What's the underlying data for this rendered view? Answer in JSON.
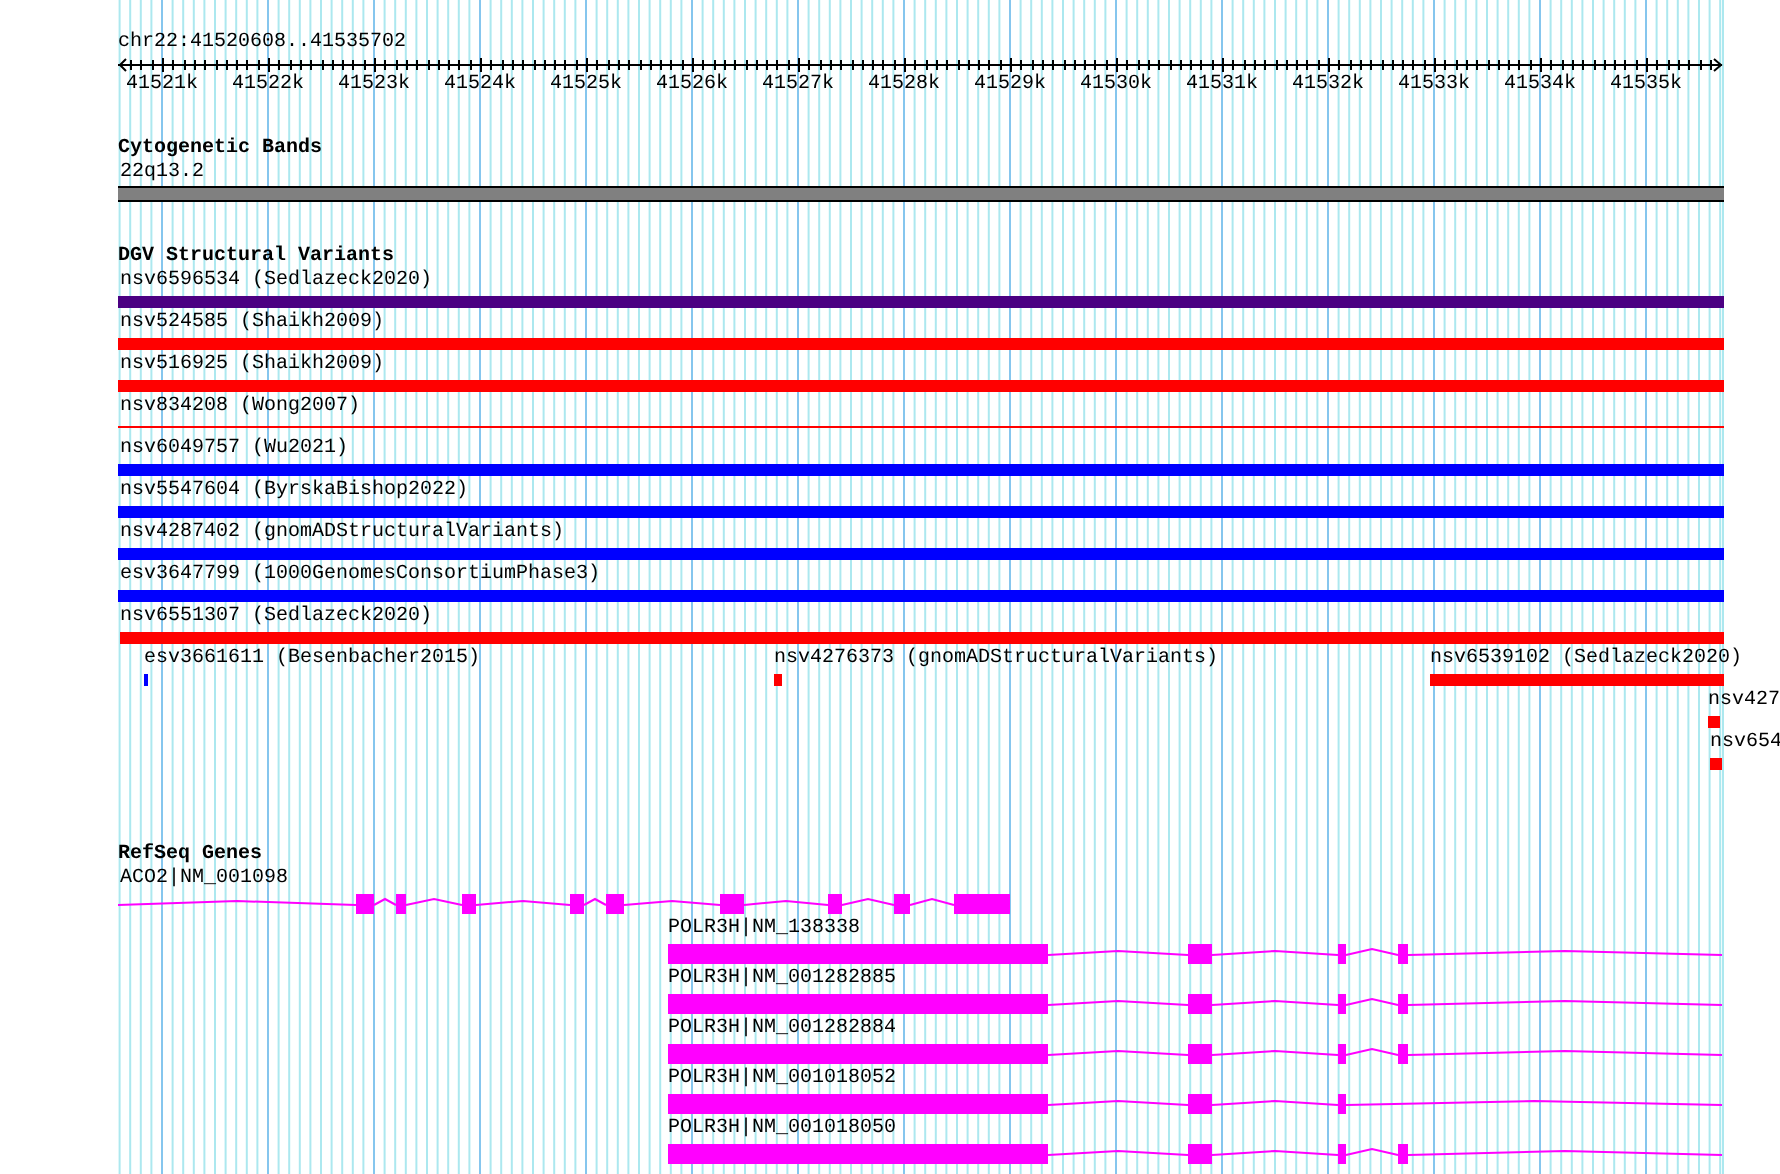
{
  "location": "chr22:41520608..41535702",
  "ruler": {
    "ticks": [
      "41521k",
      "41522k",
      "41523k",
      "41524k",
      "41525k",
      "41526k",
      "41527k",
      "41528k",
      "41529k",
      "41530k",
      "41531k",
      "41532k",
      "41533k",
      "41534k",
      "41535k"
    ]
  },
  "tracks": [
    {
      "kind": "bands",
      "title": "Cytogenetic Bands",
      "features": [
        {
          "label": "22q13.2"
        }
      ]
    },
    {
      "kind": "variants",
      "title": "DGV Structural Variants",
      "rows": [
        {
          "features": [
            {
              "label": "nsv6596534 (Sedlazeck2020)",
              "color": "#4b0082",
              "kind": "bar"
            }
          ]
        },
        {
          "features": [
            {
              "label": "nsv524585 (Shaikh2009)",
              "color": "#ff0000",
              "kind": "bar"
            }
          ]
        },
        {
          "features": [
            {
              "label": "nsv516925 (Shaikh2009)",
              "color": "#ff0000",
              "kind": "bar"
            }
          ]
        },
        {
          "features": [
            {
              "label": "nsv834208 (Wong2007)",
              "color": "#ff0000",
              "kind": "line"
            }
          ]
        },
        {
          "features": [
            {
              "label": "nsv6049757 (Wu2021)",
              "color": "#0000ff",
              "kind": "bar"
            }
          ]
        },
        {
          "features": [
            {
              "label": "nsv5547604 (ByrskaBishop2022)",
              "color": "#0000ff",
              "kind": "bar"
            }
          ]
        },
        {
          "features": [
            {
              "label": "nsv4287402 (gnomADStructuralVariants)",
              "color": "#0000ff",
              "kind": "bar"
            }
          ]
        },
        {
          "features": [
            {
              "label": "esv3647799 (1000GenomesConsortiumPhase3)",
              "color": "#0000ff",
              "kind": "bar"
            }
          ]
        },
        {
          "features": [
            {
              "label": "nsv6551307 (Sedlazeck2020)",
              "color": "#ff0000",
              "kind": "bar"
            }
          ]
        },
        {
          "features": [
            {
              "label": "esv3661611 (Besenbacher2015)",
              "color": "#0000ff",
              "kind": "bar"
            },
            {
              "label": "nsv4276373 (gnomADStructuralVariants)",
              "color": "#ff0000",
              "kind": "bar"
            },
            {
              "label": "nsv6539102 (Sedlazeck2020)",
              "color": "#ff0000",
              "kind": "bar"
            }
          ]
        },
        {
          "features": [
            {
              "label": "nsv427",
              "color": "#ff0000",
              "kind": "bar"
            }
          ]
        },
        {
          "features": [
            {
              "label": "nsv654",
              "color": "#ff0000",
              "kind": "bar"
            }
          ]
        }
      ]
    },
    {
      "kind": "genes",
      "title": "RefSeq Genes",
      "features": [
        {
          "label": "ACO2|NM_001098"
        },
        {
          "label": "POLR3H|NM_138338"
        },
        {
          "label": "POLR3H|NM_001282885"
        },
        {
          "label": "POLR3H|NM_001282884"
        },
        {
          "label": "POLR3H|NM_001018052"
        },
        {
          "label": "POLR3H|NM_001018050"
        }
      ]
    }
  ]
}
